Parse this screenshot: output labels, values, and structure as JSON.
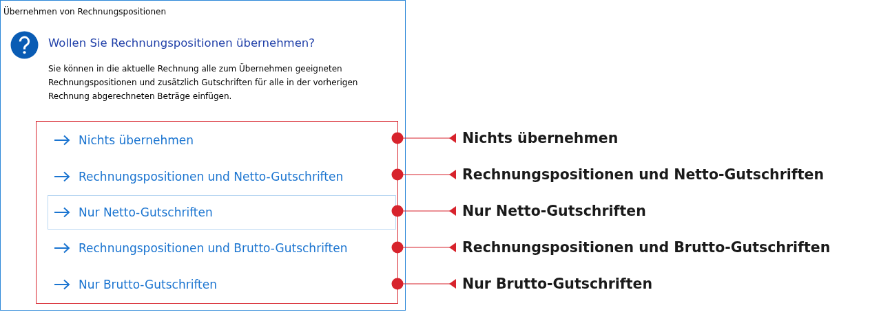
{
  "window": {
    "title": "Übernehmen von Rechnungspositionen"
  },
  "dialog": {
    "heading": "Wollen Sie Rechnungspositionen übernehmen?",
    "message": "Sie können in die aktuelle Rechnung alle zum Übernehmen geeigneten Rechnungspositionen und zusätzlich Gutschriften für alle in der vorherigen Rechnung abgerechneten Beträge einfügen."
  },
  "options": [
    {
      "label": "Nichts übernehmen",
      "selected": false
    },
    {
      "label": "Rechnungspositionen und Netto-Gutschriften",
      "selected": false
    },
    {
      "label": "Nur Netto-Gutschriften",
      "selected": true
    },
    {
      "label": "Rechnungspositionen und Brutto-Gutschriften",
      "selected": false
    },
    {
      "label": "Nur Brutto-Gutschriften",
      "selected": false
    }
  ],
  "annotations": [
    {
      "label": "Nichts übernehmen"
    },
    {
      "label": "Rechnungspositionen und Netto-Gutschriften"
    },
    {
      "label": "Nur Netto-Gutschriften"
    },
    {
      "label": "Rechnungspositionen und Brutto-Gutschriften"
    },
    {
      "label": "Nur Brutto-Gutschriften"
    }
  ]
}
